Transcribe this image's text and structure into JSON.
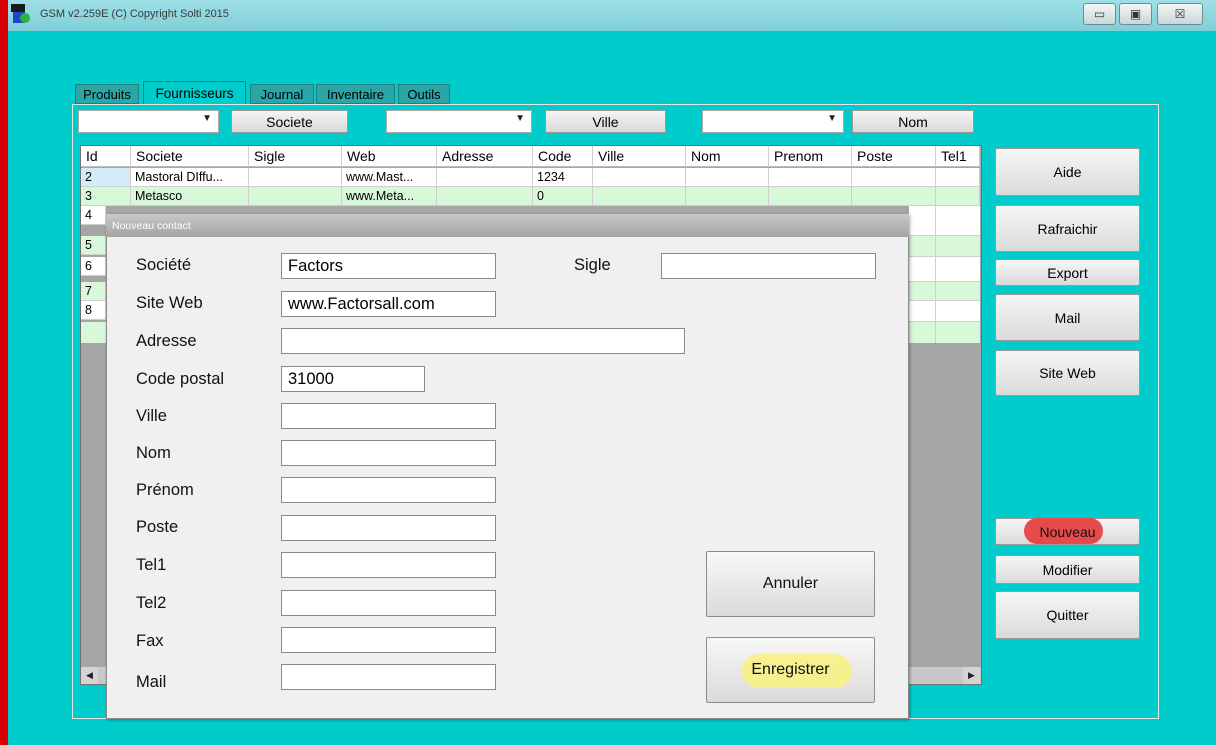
{
  "window": {
    "title": "GSM v2.259E (C) Copyright Solti 2015",
    "controls": [
      "minimize-icon",
      "maximize-icon",
      "close-icon"
    ],
    "minimize_glyph": "▭",
    "maximize_glyph": "▣",
    "close_glyph": "☒"
  },
  "colors": {
    "background": "#00cccc",
    "highlight_green": "#d9f7d9",
    "highlight_yellow": "#f7f08a",
    "highlight_red": "#e74a4a"
  },
  "tabs": [
    {
      "label": "Produits",
      "active": false
    },
    {
      "label": "Fournisseurs",
      "active": true
    },
    {
      "label": "Journal",
      "active": false
    },
    {
      "label": "Inventaire",
      "active": false
    },
    {
      "label": "Outils",
      "active": false
    }
  ],
  "search": {
    "combo_arrow": "▼",
    "btn_societe": "Societe",
    "btn_ville": "Ville",
    "btn_nom": "Nom"
  },
  "grid": {
    "columns": [
      "Id",
      "Societe",
      "Sigle",
      "Web",
      "Adresse",
      "Code",
      "Ville",
      "Nom",
      "Prenom",
      "Poste",
      "Tel1"
    ],
    "rows": [
      {
        "id": "2",
        "societe": "Mastoral DIffu...",
        "sigle": "",
        "web": "www.Mast...",
        "adresse": "",
        "code": "1234"
      },
      {
        "id": "3",
        "societe": "Metasco",
        "sigle": "",
        "web": "www.Meta...",
        "adresse": "",
        "code": "0"
      },
      {
        "id": "4"
      },
      {
        "id": "5"
      },
      {
        "id": "6"
      },
      {
        "id": "7"
      },
      {
        "id": "8"
      }
    ],
    "scroll_left": "◀",
    "scroll_right": "▶"
  },
  "right_buttons": {
    "aide": "Aide",
    "rafraichir": "Rafraichir",
    "export": "Export",
    "mail": "Mail",
    "site_web": "Site Web",
    "nouveau": "Nouveau",
    "modifier": "Modifier",
    "quitter": "Quitter"
  },
  "dialog": {
    "title": "Nouveau contact",
    "labels": {
      "societe": "Société",
      "sigle": "Sigle",
      "site_web": "Site Web",
      "adresse": "Adresse",
      "code_postal": "Code postal",
      "ville": "Ville",
      "nom": "Nom",
      "prenom": "Prénom",
      "poste": "Poste",
      "tel1": "Tel1",
      "tel2": "Tel2",
      "fax": "Fax",
      "mail": "Mail"
    },
    "values": {
      "societe": "Factors",
      "sigle": "",
      "site_web": "www.Factorsall.com",
      "adresse": "",
      "code_postal": "31000",
      "ville": "",
      "nom": "",
      "prenom": "",
      "poste": "",
      "tel1": "",
      "tel2": "",
      "fax": "",
      "mail": ""
    },
    "btn_annuler": "Annuler",
    "btn_enregistrer": "Enregistrer"
  }
}
